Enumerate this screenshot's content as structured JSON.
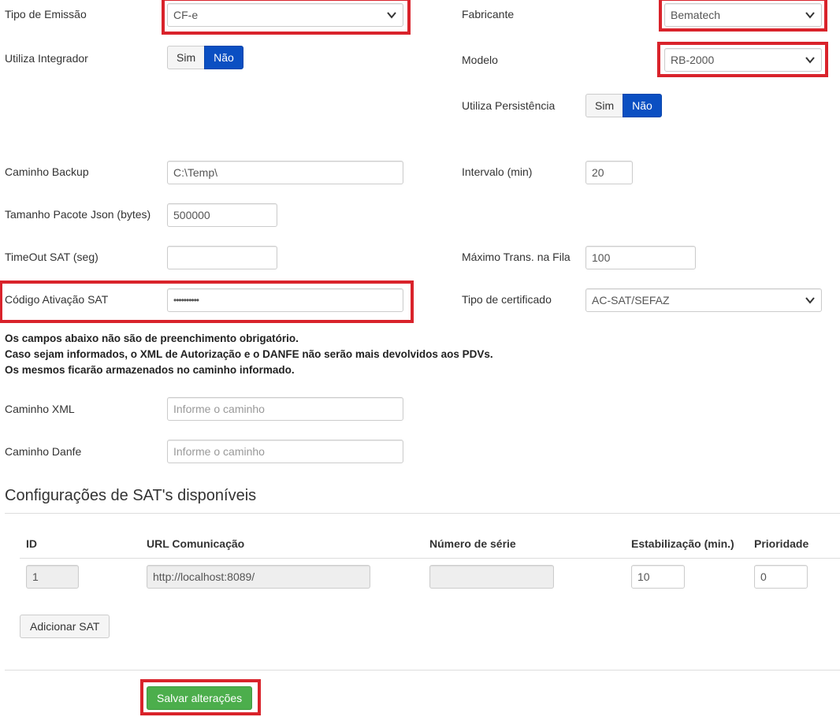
{
  "form": {
    "tipo_emissao": {
      "label": "Tipo de Emissão",
      "value": "CF-e"
    },
    "fabricante": {
      "label": "Fabricante",
      "value": "Bematech"
    },
    "utiliza_integrador": {
      "label": "Utiliza Integrador",
      "sim": "Sim",
      "nao": "Não",
      "selected": "Não"
    },
    "modelo": {
      "label": "Modelo",
      "value": "RB-2000"
    },
    "utiliza_persistencia": {
      "label": "Utiliza Persistência",
      "sim": "Sim",
      "nao": "Não",
      "selected": "Não"
    },
    "caminho_backup": {
      "label": "Caminho Backup",
      "value": "C:\\Temp\\"
    },
    "intervalo": {
      "label": "Intervalo (min)",
      "value": "20"
    },
    "tamanho_pacote": {
      "label": "Tamanho Pacote Json (bytes)",
      "value": "500000"
    },
    "timeout_sat": {
      "label": "TimeOut SAT (seg)",
      "value": ""
    },
    "maximo_trans": {
      "label": "Máximo Trans. na Fila",
      "value": "100"
    },
    "codigo_ativacao": {
      "label": "Código Ativação SAT",
      "value": "••••••••••"
    },
    "tipo_certificado": {
      "label": "Tipo de certificado",
      "value": "AC-SAT/SEFAZ"
    },
    "caminho_xml": {
      "label": "Caminho XML",
      "placeholder": "Informe o caminho"
    },
    "caminho_danfe": {
      "label": "Caminho Danfe",
      "placeholder": "Informe o caminho"
    }
  },
  "notes": [
    "Os campos abaixo não são de preenchimento obrigatório.",
    "Caso sejam informados, o XML de Autorização e o DANFE não serão mais devolvidos aos PDVs.",
    "Os mesmos ficarão armazenados no caminho informado."
  ],
  "sat_section": {
    "title": "Configurações de SAT's disponíveis",
    "columns": [
      "ID",
      "URL Comunicação",
      "Número de série",
      "Estabilização (min.)",
      "Prioridade"
    ],
    "rows": [
      {
        "id": "1",
        "url": "http://localhost:8089/",
        "numero_serie": "",
        "estabilizacao": "10",
        "prioridade": "0"
      }
    ],
    "add_button": "Adicionar SAT"
  },
  "actions": {
    "save": "Salvar alterações"
  },
  "colors": {
    "highlight": "#d9232b",
    "toggle_active": "#0b4fc2",
    "save_button": "#4cae4c"
  }
}
